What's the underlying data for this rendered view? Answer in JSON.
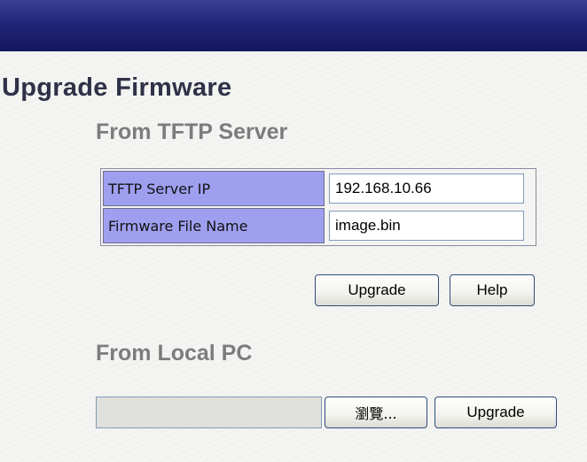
{
  "header": {
    "bar_color": "#1f2377"
  },
  "page": {
    "title": "Upgrade Firmware"
  },
  "tftp_section": {
    "title": "From TFTP Server",
    "fields": [
      {
        "label": "TFTP Server IP",
        "value": "192.168.10.66"
      },
      {
        "label": "Firmware File Name",
        "value": "image.bin"
      }
    ],
    "upgrade_label": "Upgrade",
    "help_label": "Help"
  },
  "local_section": {
    "title": "From Local PC",
    "file_path_value": "",
    "browse_label": "瀏覽...",
    "upgrade_label": "Upgrade"
  },
  "colors": {
    "label_cell_bg": "#9f9ff0",
    "section_title": "#7c7c7c",
    "page_title": "#2f3247"
  }
}
